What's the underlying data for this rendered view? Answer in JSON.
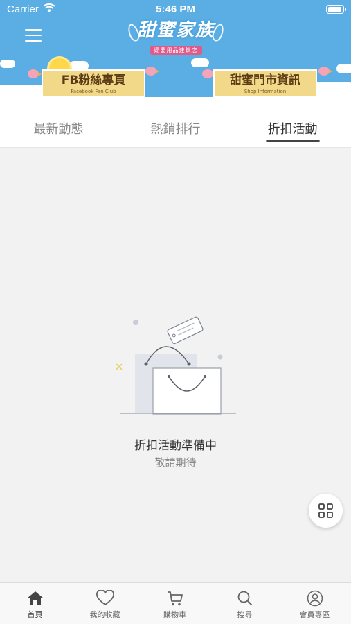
{
  "status_bar": {
    "carrier": "Carrier",
    "time": "5:46 PM"
  },
  "header": {
    "logo_title": "甜蜜家族",
    "logo_subtitle": "婦嬰用品連鎖店",
    "banners": [
      {
        "title": "FB粉絲專頁",
        "subtitle": "Facebook Fan Club"
      },
      {
        "title": "甜蜜門市資訊",
        "subtitle": "Shop Information"
      }
    ]
  },
  "tabs": [
    {
      "label": "最新動態",
      "active": false
    },
    {
      "label": "熱銷排行",
      "active": false
    },
    {
      "label": "折扣活動",
      "active": true
    }
  ],
  "empty_state": {
    "title": "折扣活動準備中",
    "subtitle": "敬請期待"
  },
  "bottom_nav": [
    {
      "label": "首頁",
      "icon": "home-icon",
      "active": true
    },
    {
      "label": "我的收藏",
      "icon": "heart-icon",
      "active": false
    },
    {
      "label": "購物車",
      "icon": "cart-icon",
      "active": false
    },
    {
      "label": "搜尋",
      "icon": "search-icon",
      "active": false
    },
    {
      "label": "會員專區",
      "icon": "user-icon",
      "active": false
    }
  ],
  "colors": {
    "header_bg": "#5aaee4",
    "banner_bg": "#f2d98a",
    "accent": "#444444"
  }
}
